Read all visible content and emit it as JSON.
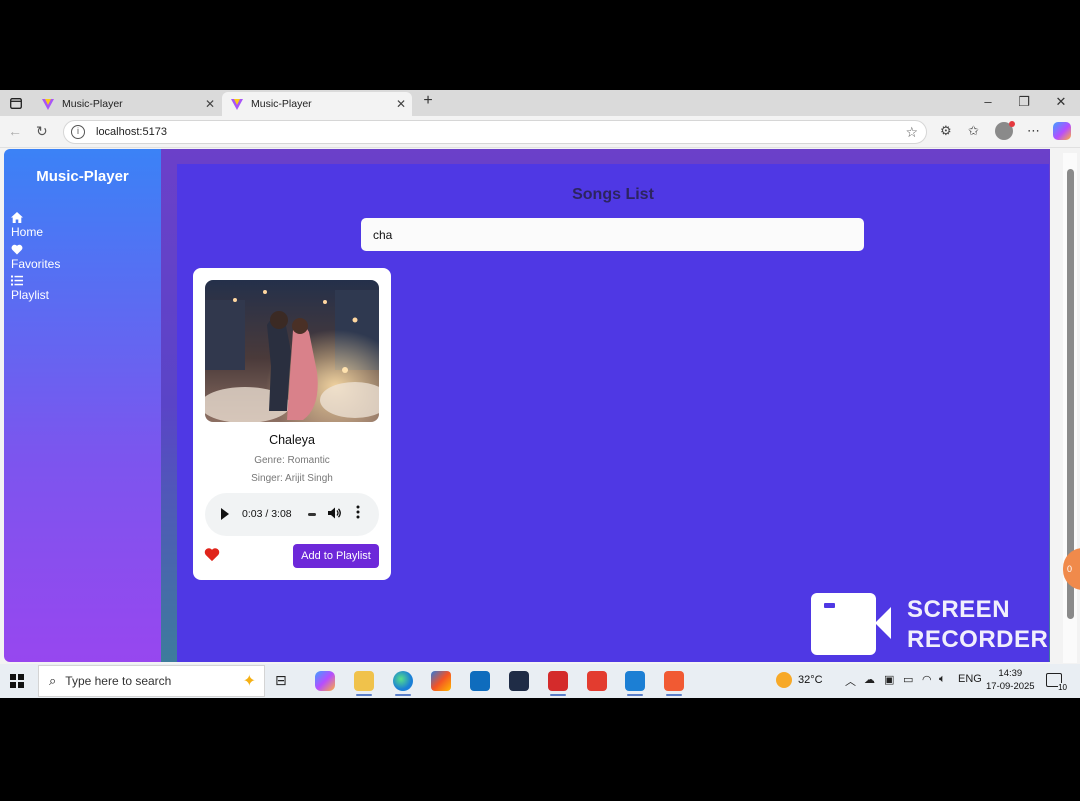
{
  "browser": {
    "tabs": [
      {
        "label": "Music-Player",
        "active": false
      },
      {
        "label": "Music-Player",
        "active": true
      }
    ],
    "new_tab_symbol": "+",
    "url": "localhost:5173"
  },
  "app": {
    "brand": "Music-Player",
    "nav": [
      {
        "label": "Home",
        "icon": "home-icon"
      },
      {
        "label": "Favorites",
        "icon": "heart-icon"
      },
      {
        "label": "Playlist",
        "icon": "list-icon"
      }
    ],
    "page_title": "Songs List",
    "search": {
      "value": "cha"
    },
    "song": {
      "title": "Chaleya",
      "genre": "Genre: Romantic",
      "singer": "Singer: Arijit Singh",
      "time": "0:03 / 3:08",
      "favorite": true,
      "add_label": "Add to Playlist"
    }
  },
  "overlay": {
    "recorder_line1": "SCREEN",
    "recorder_line2": "RECORDER",
    "side_bubble": "0"
  },
  "taskbar": {
    "search_placeholder": "Type here to search",
    "weather": "32°C",
    "language": "ENG",
    "time": "14:39",
    "date": "17-09-2025",
    "notifications": "10"
  },
  "colors": {
    "accent": "#4f38e4",
    "button": "#6d28d9",
    "heart": "#e0241b"
  }
}
